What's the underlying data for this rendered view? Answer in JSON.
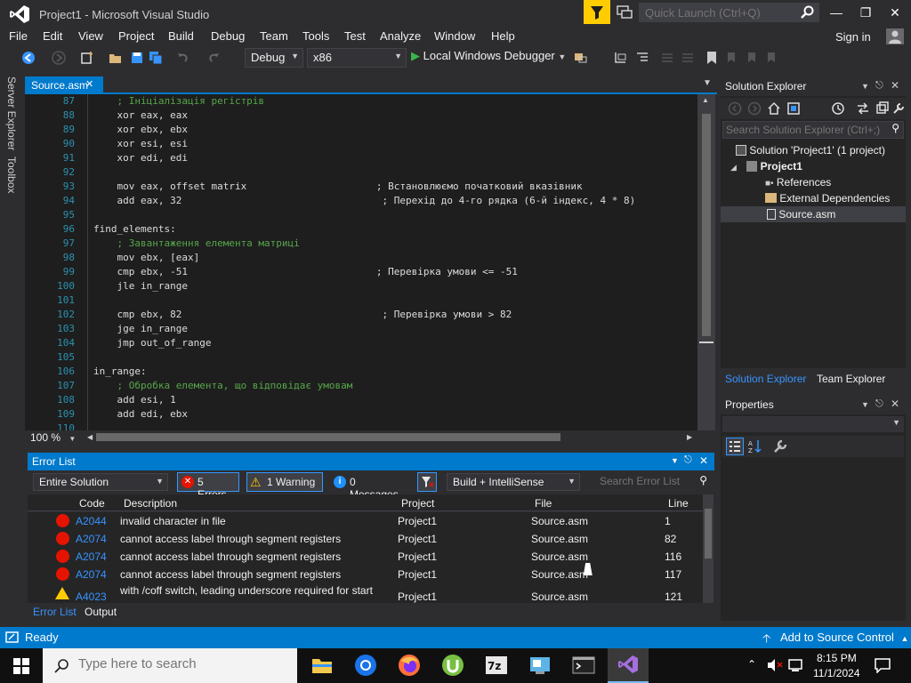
{
  "window": {
    "title": "Project1 - Microsoft Visual Studio",
    "quick_launch_placeholder": "Quick Launch (Ctrl+Q)",
    "controls": [
      "minimize",
      "maximize",
      "close"
    ]
  },
  "menu": {
    "items": [
      "File",
      "Edit",
      "View",
      "Project",
      "Build",
      "Debug",
      "Team",
      "Tools",
      "Test",
      "Analyze",
      "Window",
      "Help"
    ],
    "sign_in": "Sign in"
  },
  "toolbar": {
    "configuration": "Debug",
    "platform": "x86",
    "debugger": "Local Windows Debugger"
  },
  "side_tabs": [
    "Server Explorer",
    "Toolbox"
  ],
  "editor": {
    "tab_label": "Source.asm",
    "zoom": "100 %",
    "lines": [
      {
        "num": "87",
        "text": "    ; Ініціалізація регістрів"
      },
      {
        "num": "88",
        "text": "    xor eax, eax"
      },
      {
        "num": "89",
        "text": "    xor ebx, ebx"
      },
      {
        "num": "90",
        "text": "    xor esi, esi"
      },
      {
        "num": "91",
        "text": "    xor edi, edi"
      },
      {
        "num": "92",
        "text": ""
      },
      {
        "num": "93",
        "text": "    mov eax, offset matrix                      ; Встановлюємо початковий вказівник"
      },
      {
        "num": "94",
        "text": "    add eax, 32                                  ; Перехід до 4-го рядка (6-й індекс, 4 * 8)"
      },
      {
        "num": "95",
        "text": ""
      },
      {
        "num": "96",
        "text": "find_elements:"
      },
      {
        "num": "97",
        "text": "    ; Завантаження елемента матриці"
      },
      {
        "num": "98",
        "text": "    mov ebx, [eax]"
      },
      {
        "num": "99",
        "text": "    cmp ebx, -51                                ; Перевірка умови <= -51"
      },
      {
        "num": "100",
        "text": "    jle in_range"
      },
      {
        "num": "101",
        "text": ""
      },
      {
        "num": "102",
        "text": "    cmp ebx, 82                                  ; Перевірка умови > 82"
      },
      {
        "num": "103",
        "text": "    jge in_range"
      },
      {
        "num": "104",
        "text": "    jmp out_of_range"
      },
      {
        "num": "105",
        "text": ""
      },
      {
        "num": "106",
        "text": "in_range:"
      },
      {
        "num": "107",
        "text": "    ; Обробка елемента, що відповідає умовам"
      },
      {
        "num": "108",
        "text": "    add esi, 1"
      },
      {
        "num": "109",
        "text": "    add edi, ebx"
      },
      {
        "num": "110",
        "text": ""
      }
    ]
  },
  "error_list": {
    "title": "Error List",
    "scope": "Entire Solution",
    "errors_btn": "5 Errors",
    "warnings_btn": "1 Warning",
    "messages_btn": "0 Messages",
    "source_filter": "Build + IntelliSense",
    "search_placeholder": "Search Error List",
    "columns": [
      "Code",
      "Description",
      "Project",
      "File",
      "Line"
    ],
    "rows": [
      {
        "type": "error",
        "code": "A2044",
        "description": "invalid character in file",
        "project": "Project1",
        "file": "Source.asm",
        "line": "1"
      },
      {
        "type": "error",
        "code": "A2074",
        "description": "cannot access label through segment registers",
        "project": "Project1",
        "file": "Source.asm",
        "line": "82"
      },
      {
        "type": "error",
        "code": "A2074",
        "description": "cannot access label through segment registers",
        "project": "Project1",
        "file": "Source.asm",
        "line": "116"
      },
      {
        "type": "error",
        "code": "A2074",
        "description": "cannot access label through segment registers",
        "project": "Project1",
        "file": "Source.asm",
        "line": "117"
      },
      {
        "type": "warning",
        "code": "A4023",
        "description": "with /coff switch, leading underscore required for start",
        "project": "Project1",
        "file": "Source.asm",
        "line": "121"
      }
    ],
    "tabs": [
      "Error List",
      "Output"
    ]
  },
  "solution_explorer": {
    "title": "Solution Explorer",
    "search_placeholder": "Search Solution Explorer (Ctrl+;)",
    "solution": "Solution 'Project1' (1 project)",
    "project": "Project1",
    "items": [
      "References",
      "External Dependencies",
      "Source.asm"
    ],
    "tabs": [
      "Solution Explorer",
      "Team Explorer"
    ]
  },
  "properties": {
    "title": "Properties"
  },
  "status": {
    "left": "Ready",
    "right": "Add to Source Control"
  },
  "taskbar": {
    "search_placeholder": "Type here to search",
    "time": "8:15 PM",
    "date": "11/1/2024"
  },
  "colors": {
    "accent": "#007acc",
    "error": "#e51400",
    "warning": "#ffcc00",
    "link": "#3794ff"
  }
}
